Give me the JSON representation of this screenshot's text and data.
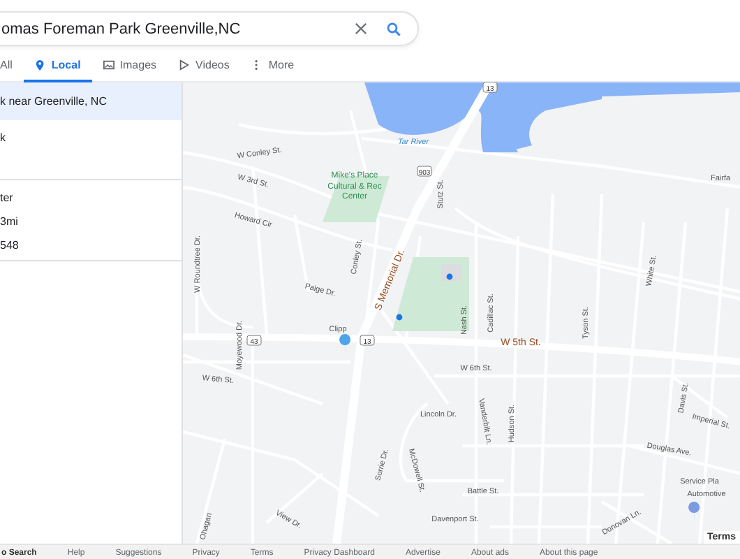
{
  "search": {
    "value": "omas Foreman Park Greenville,NC"
  },
  "tabs": [
    {
      "label": "All",
      "selected": false
    },
    {
      "label": "Local",
      "selected": true
    },
    {
      "label": "Images",
      "selected": false
    },
    {
      "label": "Videos",
      "selected": false
    },
    {
      "label": "More",
      "selected": false
    }
  ],
  "results": {
    "header": "k near Greenville, NC",
    "items": [
      {
        "lines": [
          "k"
        ]
      },
      {
        "lines": [
          "ter",
          "3mi",
          "548"
        ]
      }
    ]
  },
  "map": {
    "labels": [
      {
        "text": "Tar River",
        "kind": "water"
      },
      {
        "text": "W Conley St.",
        "kind": "street"
      },
      {
        "text": "W 3rd St.",
        "kind": "street"
      },
      {
        "text": "Mike's Place",
        "kind": "poi"
      },
      {
        "text": "Cultural & Rec",
        "kind": "poi"
      },
      {
        "text": "Center",
        "kind": "poi"
      },
      {
        "text": "903",
        "kind": "shield"
      },
      {
        "text": "Stutz St.",
        "kind": "street"
      },
      {
        "text": "Howard Cir",
        "kind": "street"
      },
      {
        "text": "W Roundtree Dr.",
        "kind": "street"
      },
      {
        "text": "Conley St.",
        "kind": "street"
      },
      {
        "text": "S Memorial Dr.",
        "kind": "major"
      },
      {
        "text": "Paige Dr.",
        "kind": "street"
      },
      {
        "text": "Moyewood Dr.",
        "kind": "street"
      },
      {
        "text": "43",
        "kind": "shield"
      },
      {
        "text": "Clipp",
        "kind": "street"
      },
      {
        "text": "13",
        "kind": "shield"
      },
      {
        "text": "Nash St.",
        "kind": "street"
      },
      {
        "text": "Cadillac St.",
        "kind": "street"
      },
      {
        "text": "Tyson St.",
        "kind": "street"
      },
      {
        "text": "White St.",
        "kind": "street"
      },
      {
        "text": "Fairfa",
        "kind": "street"
      },
      {
        "text": "W 5th St.",
        "kind": "major"
      },
      {
        "text": "W 6th St.",
        "kind": "street"
      },
      {
        "text": "W 6th St.",
        "kind": "street"
      },
      {
        "text": "Lincoln Dr.",
        "kind": "street"
      },
      {
        "text": "Vanderbilt Ln.",
        "kind": "street"
      },
      {
        "text": "Hudson St.",
        "kind": "street"
      },
      {
        "text": "Davis St.",
        "kind": "street"
      },
      {
        "text": "Imperial St.",
        "kind": "street"
      },
      {
        "text": "Douglas Ave.",
        "kind": "street"
      },
      {
        "text": "Sorrie Dr.",
        "kind": "street"
      },
      {
        "text": "McDowell St.",
        "kind": "street"
      },
      {
        "text": "Battle St.",
        "kind": "street"
      },
      {
        "text": "Davenport St.",
        "kind": "street"
      },
      {
        "text": "Donovan Ln.",
        "kind": "street"
      },
      {
        "text": "View Dr.",
        "kind": "street"
      },
      {
        "text": "Ohagan",
        "kind": "street"
      },
      {
        "text": "Service Pla",
        "kind": "poi2"
      },
      {
        "text": "Automotive",
        "kind": "poi2"
      },
      {
        "text": "13",
        "kind": "shield"
      }
    ],
    "terms": "Terms"
  },
  "footer": [
    "o Search",
    "Help",
    "Suggestions",
    "Privacy",
    "Terms",
    "Privacy Dashboard",
    "Advertise",
    "About ads",
    "About this page"
  ]
}
